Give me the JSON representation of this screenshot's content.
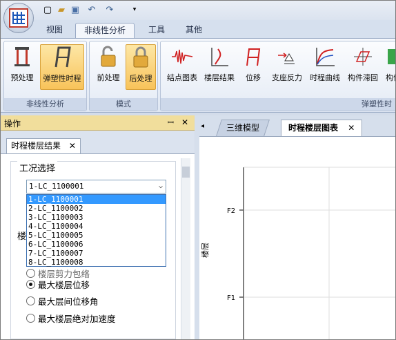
{
  "tabs": [
    "视图",
    "非线性分析",
    "工具",
    "其他"
  ],
  "ribbon": {
    "groups": [
      "非线性分析",
      "模式",
      "弹塑性时"
    ],
    "buttons": [
      "预处理",
      "弹塑性时程",
      "前处理",
      "后处理",
      "结点图表",
      "楼层结果",
      "位移",
      "支座反力",
      "时程曲线",
      "构件滞回",
      "构件"
    ]
  },
  "panel": {
    "title": "操作",
    "pin": "ꟷ",
    "close": "✕",
    "tab_label": "时程楼层结果",
    "tab_close": "✕",
    "section": "工况选择",
    "combo_value": "1-LC_1100001",
    "options": [
      "1-LC_1100001",
      "2-LC_1100002",
      "3-LC_1100003",
      "4-LC_1100004",
      "5-LC_1100005",
      "6-LC_1100006",
      "7-LC_1100007",
      "8-LC_1100008"
    ],
    "partial_label": "楼",
    "partial_radio": "楼层剪力包络",
    "radios": [
      "最大楼层位移",
      "最大层间位移角",
      "最大楼层绝对加速度"
    ],
    "selected_radio": 0
  },
  "documents": {
    "nav": "◂",
    "tabs": [
      "三维模型",
      "时程楼层图表"
    ],
    "close": "✕"
  },
  "chart_data": {
    "type": "line",
    "ylabel": "楼层",
    "y_ticks": [
      "F2",
      "F1"
    ]
  }
}
